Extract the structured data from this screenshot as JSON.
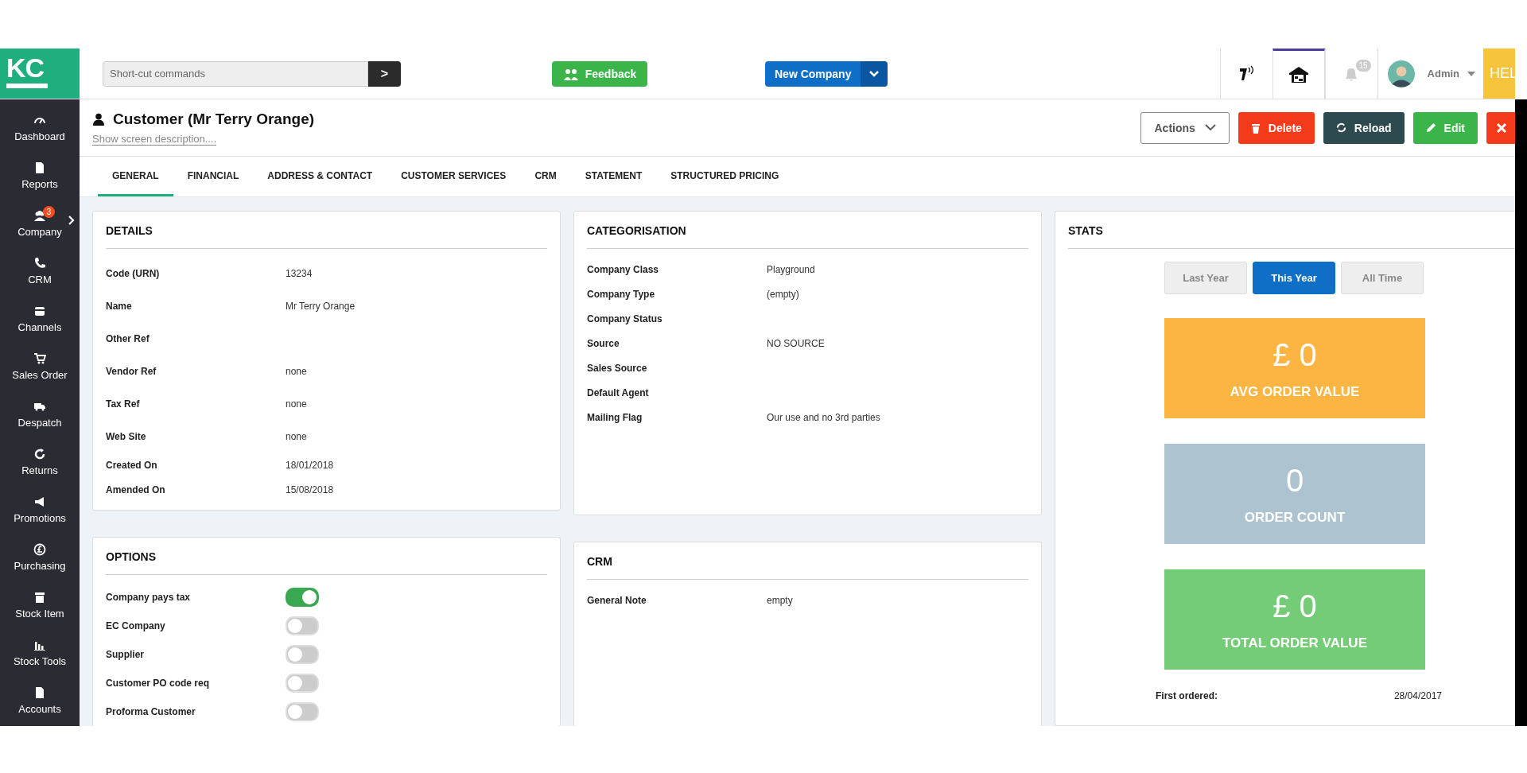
{
  "header": {
    "logo": "KC",
    "shortcut": {
      "placeholder": "Short-cut commands",
      "go": ">"
    },
    "feedback": "Feedback",
    "new_company": "New Company",
    "notifications": "15",
    "user": "Admin",
    "help": "HEL"
  },
  "sidebar": {
    "items": [
      {
        "label": "Dashboard",
        "expandable": false
      },
      {
        "label": "Reports",
        "expandable": false
      },
      {
        "label": "Company",
        "badge": "3",
        "expandable": true
      },
      {
        "label": "CRM",
        "expandable": false
      },
      {
        "label": "Channels",
        "expandable": false
      },
      {
        "label": "Sales Order",
        "expandable": false
      },
      {
        "label": "Despatch",
        "expandable": false
      },
      {
        "label": "Returns",
        "expandable": false
      },
      {
        "label": "Promotions",
        "expandable": false
      },
      {
        "label": "Purchasing",
        "expandable": false
      },
      {
        "label": "Stock Item",
        "expandable": false
      },
      {
        "label": "Stock Tools",
        "expandable": false
      },
      {
        "label": "Accounts",
        "expandable": false
      }
    ]
  },
  "page": {
    "title": "Customer (Mr Terry Orange)",
    "description_link": "Show screen description....",
    "actions": [
      {
        "kind": "dropdown",
        "label": "Actions"
      },
      {
        "kind": "delete",
        "label": "Delete"
      },
      {
        "kind": "reload",
        "label": "Reload"
      },
      {
        "kind": "edit",
        "label": "Edit"
      },
      {
        "kind": "close"
      }
    ]
  },
  "tabs": [
    {
      "label": "GENERAL",
      "selected": true
    },
    {
      "label": "FINANCIAL",
      "selected": false
    },
    {
      "label": "ADDRESS & CONTACT",
      "selected": false
    },
    {
      "label": "CUSTOMER SERVICES",
      "selected": false
    },
    {
      "label": "CRM",
      "selected": false
    },
    {
      "label": "STATEMENT",
      "selected": false
    },
    {
      "label": "STRUCTURED PRICING",
      "selected": false
    }
  ],
  "details": {
    "title": "DETAILS",
    "rows": [
      {
        "label": "Code (URN)",
        "value": "13234"
      },
      {
        "label": "Name",
        "value": "Mr Terry Orange"
      },
      {
        "label": "Other Ref"
      },
      {
        "label": "Vendor Ref",
        "value": "none"
      },
      {
        "label": "Tax Ref",
        "value": "none"
      },
      {
        "label": "Web Site",
        "value": "none"
      },
      {
        "label": "Created On",
        "value": "18/01/2018"
      },
      {
        "label": "Amended On",
        "value": "15/08/2018"
      }
    ]
  },
  "categorisation": {
    "title": "CATEGORISATION",
    "rows": [
      {
        "label": "Company Class",
        "value": "Playground"
      },
      {
        "label": "Company Type",
        "value": "(empty)"
      },
      {
        "label": "Company Status"
      },
      {
        "label": "Source",
        "value": "NO SOURCE"
      },
      {
        "label": "Sales Source"
      },
      {
        "label": "Default Agent"
      },
      {
        "label": "Mailing Flag",
        "value": "Our use and no 3rd parties"
      }
    ]
  },
  "options": {
    "title": "OPTIONS",
    "rows": [
      {
        "label": "Company pays tax",
        "on": true
      },
      {
        "label": "EC Company",
        "on": false
      },
      {
        "label": "Supplier",
        "on": false
      },
      {
        "label": "Customer PO code req",
        "on": false
      },
      {
        "label": "Proforma Customer",
        "on": false
      }
    ]
  },
  "crm": {
    "title": "CRM",
    "rows": [
      {
        "label": "General Note",
        "value": "empty"
      }
    ]
  },
  "stats": {
    "title": "STATS",
    "periods": [
      {
        "label": "Last Year",
        "selected": false
      },
      {
        "label": "This Year",
        "selected": true
      },
      {
        "label": "All Time",
        "selected": false
      }
    ],
    "tiles": [
      {
        "value": "£ 0",
        "label": "AVG ORDER VALUE",
        "color": "#fcb443"
      },
      {
        "value": "0",
        "label": "ORDER COUNT",
        "color": "#adc3d0"
      },
      {
        "value": "£ 0",
        "label": "TOTAL ORDER VALUE",
        "color": "#74cc77"
      }
    ],
    "first_ordered": {
      "label": "First ordered:",
      "value": "28/04/2017"
    }
  }
}
